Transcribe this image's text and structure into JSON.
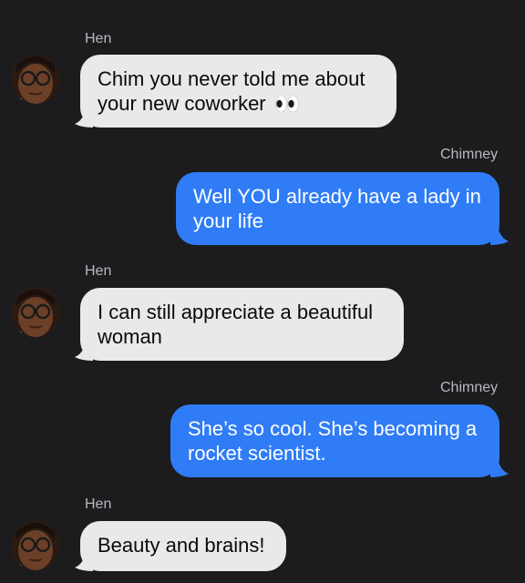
{
  "conversation": {
    "messages": [
      {
        "sender": "Hen",
        "direction": "incoming",
        "text": "Chim you never told me about your new coworker",
        "emoji": "eyes-emoji"
      },
      {
        "sender": "Chimney",
        "direction": "outgoing",
        "text": "Well YOU already have a lady in your life"
      },
      {
        "sender": "Hen",
        "direction": "incoming",
        "text": "I can still appreciate a beautiful woman"
      },
      {
        "sender": "Chimney",
        "direction": "outgoing",
        "text": "She’s so cool. She’s becoming a rocket scientist."
      },
      {
        "sender": "Hen",
        "direction": "incoming",
        "text": "Beauty and brains!"
      }
    ]
  },
  "colors": {
    "background": "#1c1c1e",
    "incoming_bubble": "#e9e9eb",
    "outgoing_bubble": "#2f7cf6",
    "sender_name": "#b9b9be"
  }
}
